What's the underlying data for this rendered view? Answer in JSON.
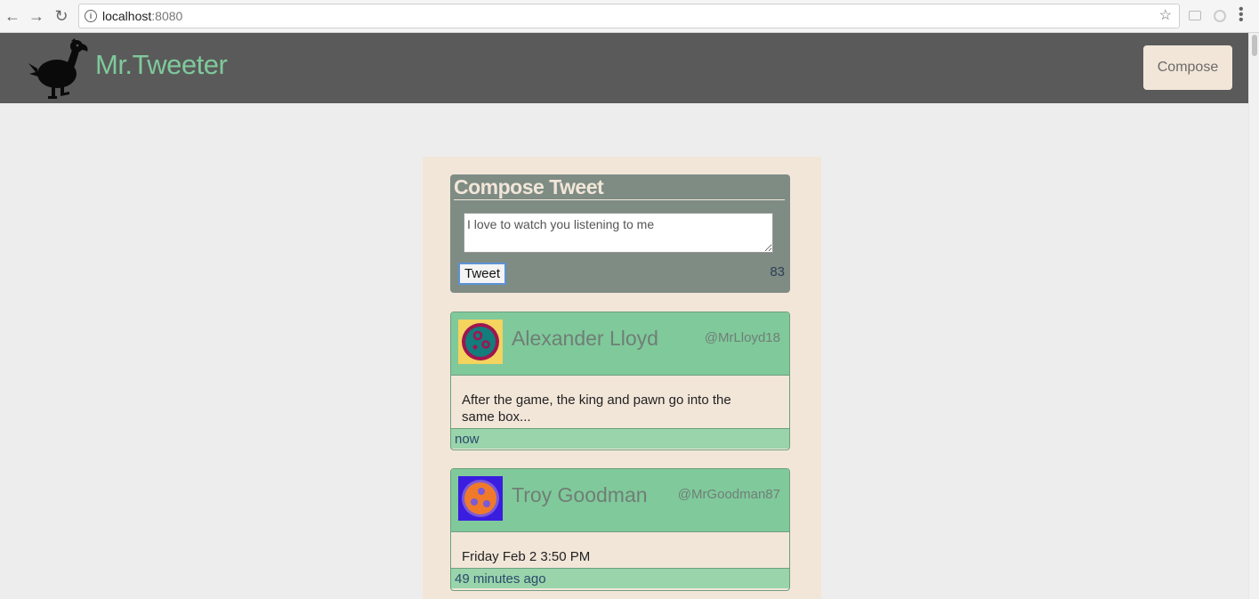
{
  "browser": {
    "url_host": "localhost",
    "url_port": ":8080"
  },
  "app": {
    "title": "Mr.Tweeter",
    "compose_button": "Compose"
  },
  "compose": {
    "title": "Compose Tweet",
    "textarea_value": "I love to watch you listening to me",
    "tweet_button": "Tweet",
    "char_counter": "83"
  },
  "tweets": [
    {
      "name": "Alexander Lloyd",
      "handle": "@MrLloyd18",
      "body": "After the game, the king and pawn go into the same box...",
      "time": "now",
      "avatar_bg": "#f4d35e",
      "avatar_fg": "#137c7c",
      "avatar_ring": "#a0154f"
    },
    {
      "name": "Troy Goodman",
      "handle": "@MrGoodman87",
      "body": "Friday Feb 2 3:50 PM",
      "time": "49 minutes ago",
      "avatar_bg": "#3b1de0",
      "avatar_fg": "#f07a2a",
      "avatar_ring": "#7a5ad8"
    }
  ],
  "colors": {
    "header_bg": "#5a5a5a",
    "accent_green": "#7fc99b",
    "panel_beige": "#f2e6d9"
  }
}
